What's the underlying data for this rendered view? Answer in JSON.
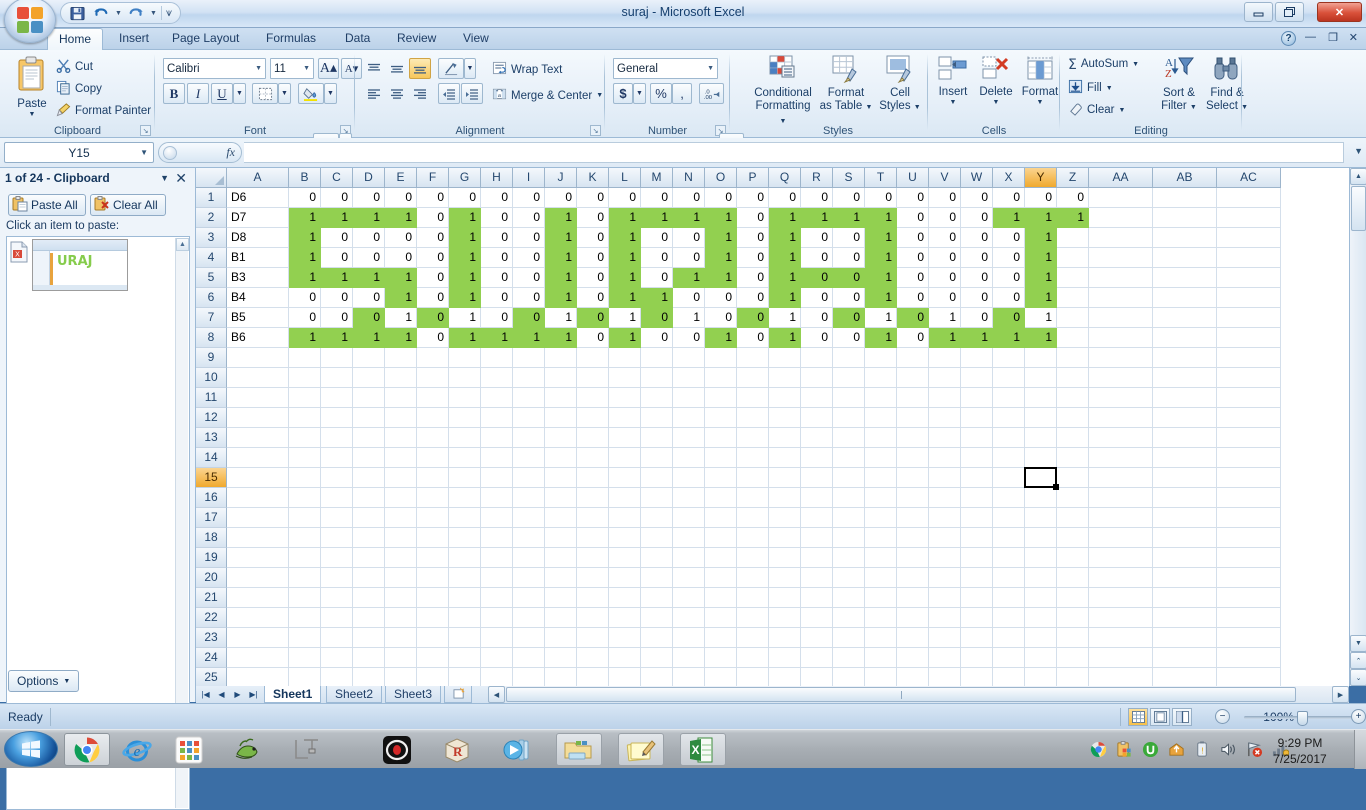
{
  "window": {
    "title": "suraj - Microsoft Excel",
    "minimize": "—",
    "maximize": "❐",
    "close": "✕",
    "help": "?",
    "ribbon_minimize": "—",
    "ribbon_restore": "❐",
    "ribbon_close": "✕"
  },
  "quick_access": {
    "save": "save-icon",
    "undo": "undo-icon",
    "redo": "redo-icon",
    "customize": "customize-icon"
  },
  "tabs": [
    {
      "label": "Home",
      "active": true
    },
    {
      "label": "Insert",
      "active": false
    },
    {
      "label": "Page Layout",
      "active": false
    },
    {
      "label": "Formulas",
      "active": false
    },
    {
      "label": "Data",
      "active": false
    },
    {
      "label": "Review",
      "active": false
    },
    {
      "label": "View",
      "active": false
    }
  ],
  "ribbon": {
    "clipboard": {
      "label": "Clipboard",
      "paste": "Paste",
      "cut": "Cut",
      "copy": "Copy",
      "format_painter": "Format Painter"
    },
    "font": {
      "label": "Font",
      "font_name": "Calibri",
      "font_size": "11",
      "grow": "A",
      "shrink": "A",
      "bold": "B",
      "italic": "I",
      "underline": "U"
    },
    "alignment": {
      "label": "Alignment",
      "wrap_text": "Wrap Text",
      "merge_center": "Merge & Center"
    },
    "number": {
      "label": "Number",
      "format": "General",
      "currency": "$",
      "percent": "%",
      "comma": ",",
      "inc_dec": "+.0",
      "dec_dec": ".00"
    },
    "styles": {
      "label": "Styles",
      "conditional_formatting": "Conditional\nFormatting",
      "conditional_formatting_l1": "Conditional",
      "conditional_formatting_l2": "Formatting",
      "format_as_table_l1": "Format",
      "format_as_table_l2": "as Table",
      "cell_styles_l1": "Cell",
      "cell_styles_l2": "Styles"
    },
    "cells": {
      "label": "Cells",
      "insert": "Insert",
      "delete": "Delete",
      "format": "Format"
    },
    "editing": {
      "label": "Editing",
      "autosum": "AutoSum",
      "fill": "Fill",
      "clear": "Clear",
      "sort_filter_l1": "Sort &",
      "sort_filter_l2": "Filter",
      "find_select_l1": "Find &",
      "find_select_l2": "Select"
    }
  },
  "formula_bar": {
    "name_box": "Y15",
    "formula": "",
    "fx": "fx"
  },
  "clipboard_pane": {
    "title": "1 of 24 - Clipboard",
    "paste_all": "Paste All",
    "clear_all": "Clear All",
    "hint": "Click an item to paste:",
    "item_thumb_text": "URAJ",
    "options": "Options"
  },
  "grid": {
    "columns": [
      "A",
      "B",
      "C",
      "D",
      "E",
      "F",
      "G",
      "H",
      "I",
      "J",
      "K",
      "L",
      "M",
      "N",
      "O",
      "P",
      "Q",
      "R",
      "S",
      "T",
      "U",
      "V",
      "W",
      "X",
      "Y",
      "Z",
      "AA",
      "AB",
      "AC"
    ],
    "selected_column": "Y",
    "selected_row": "15",
    "selected_cell": "Y15",
    "rows": [
      "1",
      "2",
      "3",
      "4",
      "5",
      "6",
      "7",
      "8",
      "9",
      "10",
      "11",
      "12",
      "13",
      "14",
      "15",
      "16",
      "17",
      "18",
      "19",
      "20",
      "21",
      "22",
      "23",
      "24",
      "25"
    ],
    "fill_color": "#92d050",
    "data": [
      [
        "D6",
        "0",
        "0",
        "0",
        "0",
        "0",
        "0",
        "0",
        "0",
        "0",
        "0",
        "0",
        "0",
        "0",
        "0",
        "0",
        "0",
        "0",
        "0",
        "0",
        "0",
        "0",
        "0",
        "0",
        "0",
        "0"
      ],
      [
        "D7",
        "1",
        "1",
        "1",
        "1",
        "0",
        "1",
        "0",
        "0",
        "1",
        "0",
        "1",
        "1",
        "1",
        "1",
        "0",
        "1",
        "1",
        "1",
        "1",
        "0",
        "0",
        "0",
        "1",
        "1",
        "1"
      ],
      [
        "D8",
        "1",
        "0",
        "0",
        "0",
        "0",
        "1",
        "0",
        "0",
        "1",
        "0",
        "1",
        "0",
        "0",
        "1",
        "0",
        "1",
        "0",
        "0",
        "1",
        "0",
        "0",
        "0",
        "0",
        "1",
        ""
      ],
      [
        "B1",
        "1",
        "0",
        "0",
        "0",
        "0",
        "1",
        "0",
        "0",
        "1",
        "0",
        "1",
        "0",
        "0",
        "1",
        "0",
        "1",
        "0",
        "0",
        "1",
        "0",
        "0",
        "0",
        "0",
        "1",
        ""
      ],
      [
        "B3",
        "1",
        "1",
        "1",
        "1",
        "0",
        "1",
        "0",
        "0",
        "1",
        "0",
        "1",
        "0",
        "1",
        "1",
        "0",
        "1",
        "0",
        "0",
        "1",
        "0",
        "0",
        "0",
        "0",
        "1",
        ""
      ],
      [
        "B4",
        "0",
        "0",
        "0",
        "1",
        "0",
        "1",
        "0",
        "0",
        "1",
        "0",
        "1",
        "1",
        "0",
        "0",
        "0",
        "1",
        "0",
        "0",
        "1",
        "0",
        "0",
        "0",
        "0",
        "1",
        ""
      ],
      [
        "B5",
        "0",
        "0",
        "0",
        "1",
        "0",
        "1",
        "0",
        "0",
        "1",
        "0",
        "1",
        "0",
        "1",
        "0",
        "0",
        "1",
        "0",
        "0",
        "1",
        "0",
        "1",
        "0",
        "0",
        "1",
        ""
      ],
      [
        "B6",
        "1",
        "1",
        "1",
        "1",
        "0",
        "1",
        "1",
        "1",
        "1",
        "0",
        "1",
        "0",
        "0",
        "1",
        "0",
        "1",
        "0",
        "0",
        "1",
        "0",
        "1",
        "1",
        "1",
        "1",
        ""
      ]
    ],
    "highlight": [
      [
        false,
        false,
        false,
        false,
        false,
        false,
        false,
        false,
        false,
        false,
        false,
        false,
        false,
        false,
        false,
        false,
        false,
        false,
        false,
        false,
        false,
        false,
        false,
        false,
        false
      ],
      [
        false,
        true,
        true,
        true,
        true,
        false,
        true,
        false,
        false,
        true,
        false,
        true,
        true,
        true,
        true,
        false,
        true,
        true,
        true,
        true,
        false,
        false,
        false,
        true,
        true,
        true
      ],
      [
        false,
        true,
        false,
        false,
        false,
        false,
        true,
        false,
        false,
        true,
        false,
        true,
        false,
        false,
        true,
        false,
        true,
        false,
        false,
        true,
        false,
        false,
        false,
        false,
        true,
        false
      ],
      [
        false,
        true,
        false,
        false,
        false,
        false,
        true,
        false,
        false,
        true,
        false,
        true,
        false,
        false,
        true,
        false,
        true,
        false,
        false,
        true,
        false,
        false,
        false,
        false,
        true,
        false
      ],
      [
        false,
        true,
        true,
        true,
        true,
        false,
        true,
        false,
        false,
        true,
        false,
        true,
        false,
        true,
        true,
        false,
        true,
        true,
        true,
        true,
        false,
        false,
        false,
        false,
        true,
        false
      ],
      [
        false,
        false,
        false,
        false,
        true,
        false,
        true,
        false,
        false,
        true,
        false,
        true,
        true,
        false,
        false,
        false,
        true,
        false,
        false,
        true,
        false,
        false,
        false,
        false,
        true,
        false
      ],
      [
        false,
        false,
        false,
        true,
        false,
        true,
        false,
        false,
        true,
        false,
        true,
        false,
        true,
        false,
        false,
        true,
        false,
        false,
        true,
        false,
        true,
        false,
        false,
        true,
        false
      ],
      [
        false,
        true,
        true,
        true,
        true,
        false,
        true,
        true,
        true,
        true,
        false,
        true,
        false,
        false,
        true,
        false,
        true,
        false,
        false,
        true,
        false,
        true,
        true,
        true,
        true,
        false
      ]
    ]
  },
  "sheet_tabs": {
    "first": "|◀",
    "prev": "◀",
    "next": "▶",
    "last": "▶|",
    "tabs": [
      {
        "label": "Sheet1",
        "active": true
      },
      {
        "label": "Sheet2",
        "active": false
      },
      {
        "label": "Sheet3",
        "active": false
      }
    ],
    "insert_sheet": "insert-sheet-icon"
  },
  "status_bar": {
    "state": "Ready",
    "view_normal": "normal-view-icon",
    "view_layout": "page-layout-view-icon",
    "view_break": "page-break-view-icon",
    "zoom": "100%",
    "zoom_out": "−",
    "zoom_in": "+"
  },
  "taskbar": {
    "start": "windows-start-icon",
    "items": [
      {
        "name": "chrome-taskbar-icon",
        "active": true
      },
      {
        "name": "internet-explorer-taskbar-icon",
        "active": false
      },
      {
        "name": "app-grid-taskbar-icon",
        "active": false
      },
      {
        "name": "dragon-taskbar-icon",
        "active": false
      },
      {
        "name": "circuit-taskbar-icon",
        "active": false
      },
      {
        "name": "opera-taskbar-icon",
        "active": false
      },
      {
        "name": "rbox-taskbar-icon",
        "active": false
      },
      {
        "name": "media-player-taskbar-icon",
        "active": false
      },
      {
        "name": "file-explorer-taskbar-icon",
        "active": true
      },
      {
        "name": "notepad-taskbar-icon",
        "active": true
      },
      {
        "name": "excel-taskbar-icon",
        "active": true
      }
    ],
    "tray": [
      "chrome-tray-icon",
      "clipboard-tray-icon",
      "utorrent-tray-icon",
      "update-tray-icon",
      "battery-tray-icon",
      "volume-tray-icon",
      "network-alert-tray-icon",
      "signal-tray-icon"
    ],
    "time": "9:29 PM",
    "date": "7/25/2017"
  }
}
